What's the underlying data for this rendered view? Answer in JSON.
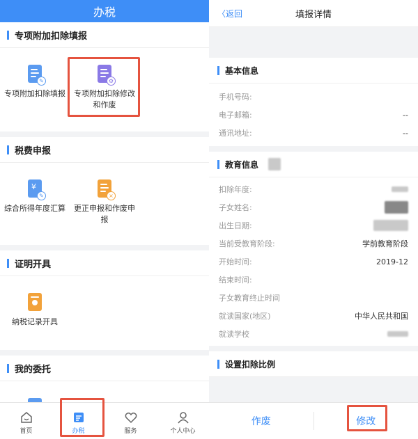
{
  "left": {
    "header_title": "办税",
    "sections": [
      {
        "title": "专项附加扣除填报",
        "items": [
          {
            "label": "专项附加扣除填报",
            "icon": "pencil-doc-icon"
          },
          {
            "label": "专项附加扣除修改和作废",
            "icon": "settings-doc-icon"
          }
        ]
      },
      {
        "title": "税费申报",
        "items": [
          {
            "label": "综合所得年度汇算",
            "icon": "yuan-doc-icon"
          },
          {
            "label": "更正申报和作废申报",
            "icon": "cancel-doc-icon"
          }
        ]
      },
      {
        "title": "证明开具",
        "items": [
          {
            "label": "纳税记录开具",
            "icon": "person-doc-icon"
          }
        ]
      },
      {
        "title": "我的委托",
        "items": []
      }
    ],
    "tabs": [
      {
        "label": "首页",
        "icon": "home-icon"
      },
      {
        "label": "办税",
        "icon": "tax-icon"
      },
      {
        "label": "服务",
        "icon": "service-icon"
      },
      {
        "label": "个人中心",
        "icon": "person-icon"
      }
    ]
  },
  "right": {
    "back_label": "返回",
    "title": "填报详情",
    "basic": {
      "title": "基本信息",
      "rows": [
        {
          "k": "手机号码:",
          "v": ""
        },
        {
          "k": "电子邮箱:",
          "v": "--"
        },
        {
          "k": "通讯地址:",
          "v": "--"
        }
      ]
    },
    "edu": {
      "title": "教育信息",
      "rows": [
        {
          "k": "扣除年度:",
          "v": ""
        },
        {
          "k": "子女姓名:",
          "v": ""
        },
        {
          "k": "出生日期:",
          "v": ""
        },
        {
          "k": "当前受教育阶段:",
          "v": "学前教育阶段"
        },
        {
          "k": "开始时间:",
          "v": "2019-12"
        },
        {
          "k": "结束时间:",
          "v": ""
        },
        {
          "k": "子女教育终止时间",
          "v": ""
        },
        {
          "k": "就读国家(地区)",
          "v": "中华人民共和国"
        },
        {
          "k": "就读学校",
          "v": ""
        }
      ]
    },
    "ratio_title": "设置扣除比例",
    "void_label": "作废",
    "modify_label": "修改"
  },
  "colors": {
    "accent": "#3e8ef7",
    "highlight": "#e5533f"
  }
}
